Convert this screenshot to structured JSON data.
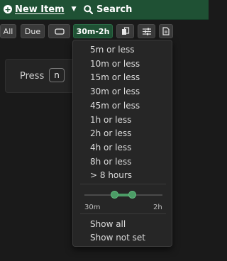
{
  "header": {
    "new_item_label": "New Item",
    "search_label": "Search"
  },
  "filters": {
    "all_label": "All",
    "due_label": "Due",
    "duration_label": "30m-2h"
  },
  "content": {
    "press_text": "Press",
    "key_text": "n"
  },
  "duration_menu": {
    "options": [
      "5m or less",
      "10m or less",
      "15m or less",
      "30m or less",
      "45m or less",
      "1h or less",
      "2h or less",
      "4h or less",
      "8h or less",
      "> 8 hours"
    ],
    "range_slider": {
      "min_label": "30m",
      "max_label": "2h"
    },
    "show_all_label": "Show all",
    "show_not_set_label": "Show not set"
  },
  "colors": {
    "header_bg": "#1f5134",
    "accent": "#4c9c66",
    "menu_bg": "#262626",
    "page_bg": "#1a1a1a"
  },
  "icons": {
    "new_item": "plus-circle-icon",
    "new_item_caret": "caret-down-icon",
    "search": "search-icon",
    "toggle": "rectangle-toggle-icon",
    "copy": "copy-icon",
    "settings": "sliders-icon",
    "notes": "document-icon"
  }
}
